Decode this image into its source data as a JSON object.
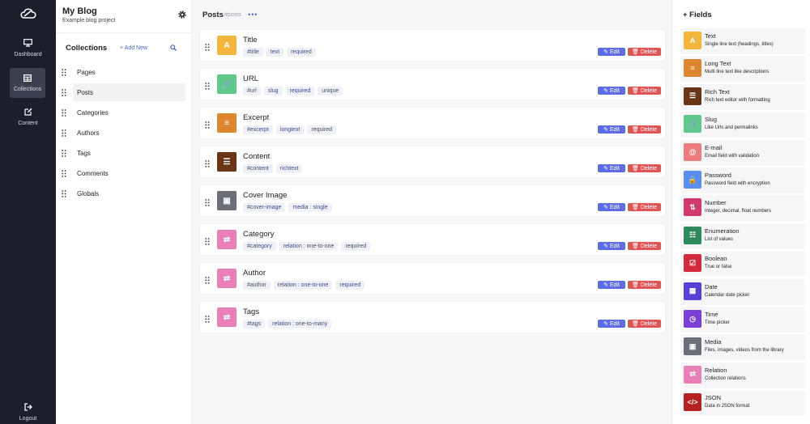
{
  "nav": {
    "items": [
      {
        "label": "Dashboard",
        "icon": "monitor-icon"
      },
      {
        "label": "Collections",
        "icon": "table-icon"
      },
      {
        "label": "Content",
        "icon": "edit-icon"
      }
    ],
    "logout": "Logout"
  },
  "project": {
    "title": "My Blog",
    "subtitle": "Example blog project"
  },
  "collections": {
    "title": "Collections",
    "add_new": "+ Add New",
    "items": [
      "Pages",
      "Posts",
      "Categories",
      "Authors",
      "Tags",
      "Comments",
      "Globals"
    ]
  },
  "main": {
    "title": "Posts",
    "tag": "#posts",
    "more": "•••",
    "edit_label": "Edit",
    "delete_label": "Delete",
    "fields": [
      {
        "name": "Title",
        "icon": "A",
        "color": "#f3b53b",
        "chips": [
          "#title",
          "text",
          "required"
        ]
      },
      {
        "name": "URL",
        "icon": "🔗",
        "color": "#5fc98b",
        "chips": [
          "#url",
          "slug",
          "required",
          "unique"
        ]
      },
      {
        "name": "Excerpt",
        "icon": "≡",
        "color": "#e0852f",
        "chips": [
          "#excerpt",
          "longtext",
          "required"
        ]
      },
      {
        "name": "Content",
        "icon": "☰",
        "color": "#6a3514",
        "chips": [
          "#content",
          "richtext"
        ]
      },
      {
        "name": "Cover Image",
        "icon": "▣",
        "color": "#6b6e78",
        "chips": [
          "#cover-image",
          "media : single"
        ]
      },
      {
        "name": "Category",
        "icon": "⇄",
        "color": "#ea7fb8",
        "chips": [
          "#category",
          "relation : one-to-one",
          "required"
        ]
      },
      {
        "name": "Author",
        "icon": "⇄",
        "color": "#ea7fb8",
        "chips": [
          "#author",
          "relation : one-to-one",
          "required"
        ]
      },
      {
        "name": "Tags",
        "icon": "⇄",
        "color": "#ea7fb8",
        "chips": [
          "#tags",
          "relation : one-to-many"
        ]
      }
    ]
  },
  "fields_panel": {
    "title": "+ Fields",
    "types": [
      {
        "name": "Text",
        "desc": "Single line text (headings, titles)",
        "icon": "A",
        "color": "#f3b53b"
      },
      {
        "name": "Long Text",
        "desc": "Multi line text like descriptions",
        "icon": "≡",
        "color": "#e0852f"
      },
      {
        "name": "Rich Text",
        "desc": "Rich text editor with formatting",
        "icon": "☰",
        "color": "#6a3514"
      },
      {
        "name": "Slug",
        "desc": "Like Urls and permalinks",
        "icon": "🔗",
        "color": "#5fc98b"
      },
      {
        "name": "E-mail",
        "desc": "Email field with validation",
        "icon": "@",
        "color": "#ef7c7c"
      },
      {
        "name": "Password",
        "desc": "Password field with encryption",
        "icon": "🔒",
        "color": "#5a8ef0"
      },
      {
        "name": "Number",
        "desc": "Integer, decimal, float numbers",
        "icon": "⇅",
        "color": "#d23a6f"
      },
      {
        "name": "Enumeration",
        "desc": "List of values",
        "icon": "☷",
        "color": "#2f8a5b"
      },
      {
        "name": "Boolean",
        "desc": "True or false",
        "icon": "☑",
        "color": "#d32b3d"
      },
      {
        "name": "Date",
        "desc": "Calendar date picker",
        "icon": "▦",
        "color": "#5a3fd8"
      },
      {
        "name": "Time",
        "desc": "Time picker",
        "icon": "◷",
        "color": "#7b3fd8"
      },
      {
        "name": "Media",
        "desc": "Files, images, videos from the library",
        "icon": "▣",
        "color": "#6b6e78"
      },
      {
        "name": "Relation",
        "desc": "Collection relations",
        "icon": "⇄",
        "color": "#ea7fb8"
      },
      {
        "name": "JSON",
        "desc": "Data in JSON format",
        "icon": "</>",
        "color": "#b52020"
      }
    ]
  }
}
